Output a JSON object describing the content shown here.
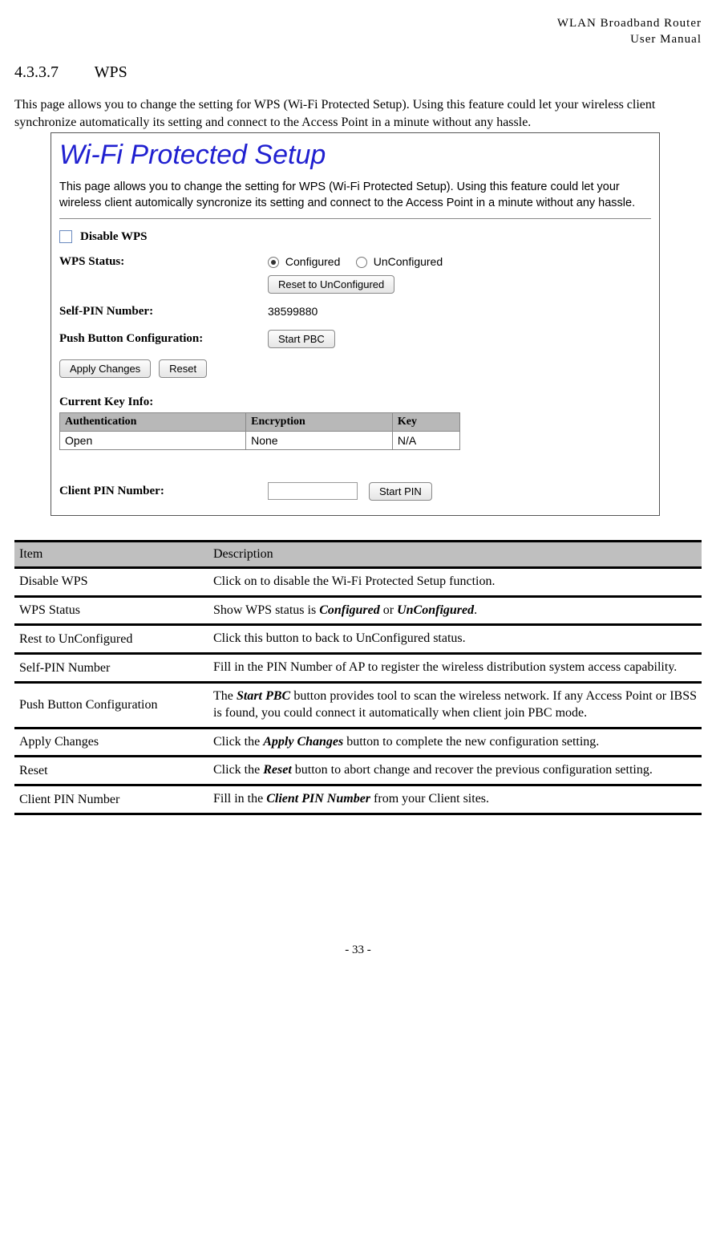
{
  "header": {
    "line1": "WLAN  Broadband  Router",
    "line2": "User  Manual"
  },
  "section": {
    "number": "4.3.3.7",
    "title": "WPS"
  },
  "intro": "This page allows you to change the setting for WPS (Wi-Fi Protected Setup). Using this feature could let your wireless client synchronize automatically its setting and connect to the Access Point in a minute without any hassle.",
  "screenshot": {
    "title": "Wi-Fi Protected Setup",
    "para": "This page allows you to change the setting for WPS (Wi-Fi Protected Setup). Using this feature could let your wireless client automically syncronize its setting and connect to the Access Point in a minute without any hassle.",
    "disable_label": "Disable WPS",
    "status_label": "WPS Status:",
    "status_opt1": "Configured",
    "status_opt2": "UnConfigured",
    "reset_unconf_btn": "Reset to UnConfigured",
    "selfpin_label": "Self-PIN Number:",
    "selfpin_value": "38599880",
    "pbc_label": "Push Button Configuration:",
    "pbc_btn": "Start PBC",
    "apply_btn": "Apply Changes",
    "reset_btn": "Reset",
    "keyinfo_label": "Current Key Info:",
    "key_table": {
      "headers": [
        "Authentication",
        "Encryption",
        "Key"
      ],
      "row": [
        "Open",
        "None",
        "N/A"
      ]
    },
    "clientpin_label": "Client PIN Number:",
    "startpin_btn": "Start PIN"
  },
  "desc_table": {
    "headers": [
      "Item",
      "Description"
    ],
    "rows": [
      {
        "item": "Disable WPS",
        "desc_plain": "Click on to disable the Wi-Fi Protected Setup function."
      },
      {
        "item": "WPS Status",
        "desc_html": "Show WPS status is <span class='bi'>Configured</span> or <span class='bi'>UnConfigured</span>."
      },
      {
        "item": "Rest to UnConfigured",
        "desc_plain": "Click this button to back to UnConfigured status."
      },
      {
        "item": "Self-PIN Number",
        "desc_plain": "Fill in the PIN Number of AP to register the wireless distribution system access capability."
      },
      {
        "item": "Push Button Configuration",
        "desc_html": "The <span class='bi'>Start PBC</span> button provides tool to scan the wireless network. If any Access Point or IBSS is found, you could connect it automatically when client join PBC mode."
      },
      {
        "item": "Apply Changes",
        "desc_html": "Click the <span class='bi'>Apply Changes</span> button to complete the new configuration setting."
      },
      {
        "item": "Reset",
        "desc_html": "Click the <span class='bi'>Reset</span> button to abort change and recover the previous configuration setting."
      },
      {
        "item": "Client PIN Number",
        "desc_html": "Fill in the <span class='bi'>Client PIN Number</span> from your Client sites."
      }
    ]
  },
  "page_number": "- 33 -"
}
